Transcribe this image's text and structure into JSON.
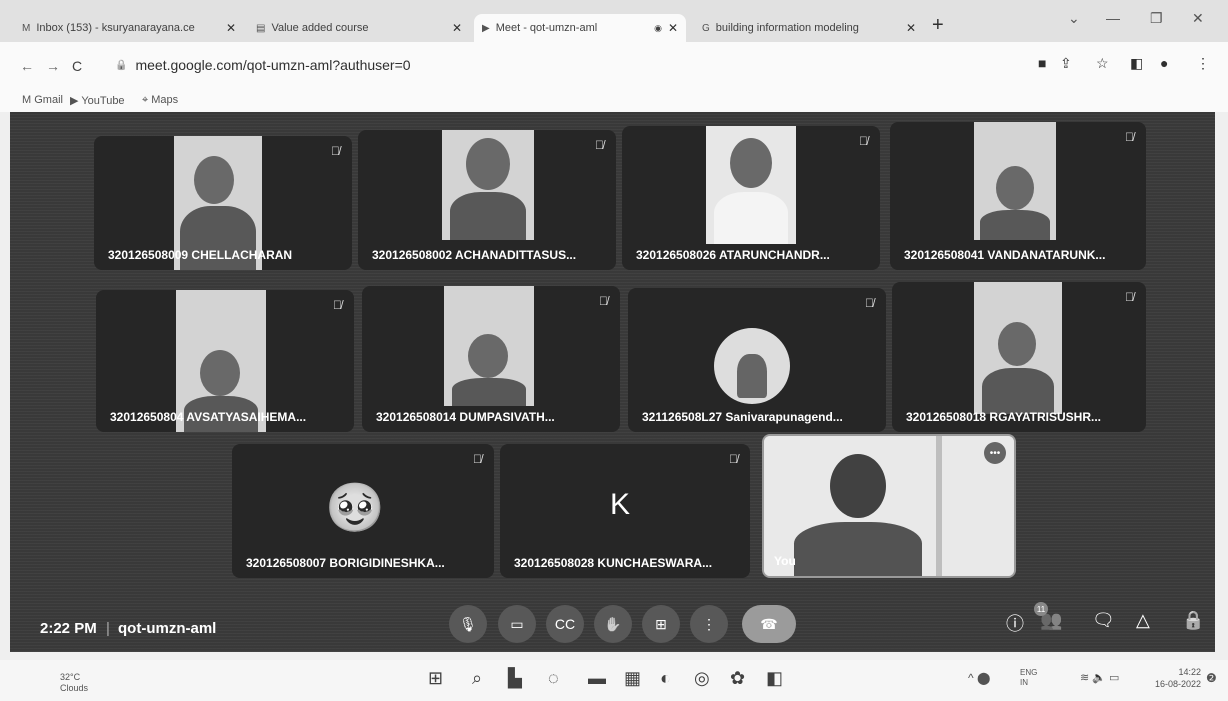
{
  "browser": {
    "tabs": [
      {
        "title": "Inbox (153) - ksuryanarayana.ce",
        "close": "✕"
      },
      {
        "title": "Value added course",
        "close": "✕"
      },
      {
        "title": "Meet - qot-umzn-aml",
        "close": "✕"
      },
      {
        "title": "building information modeling",
        "close": "✕"
      }
    ],
    "new_tab": "+",
    "url": "meet.google.com/qot-umzn-aml?authuser=0",
    "bookmarks": [
      "Gmail",
      "YouTube",
      "Maps"
    ]
  },
  "meet": {
    "participants": [
      {
        "name": "320126508009 CHELLACHARAN"
      },
      {
        "name": "320126508002 ACHANADITTASUS..."
      },
      {
        "name": "320126508026 ATARUNCHANDR..."
      },
      {
        "name": "320126508041 VANDANATARUNK..."
      },
      {
        "name": "32012650804 AVSATYASAIHEMA..."
      },
      {
        "name": "320126508014 DUMPASIVATH..."
      },
      {
        "name": "321126508L27 Sanivarapunagend..."
      },
      {
        "name": "320126508018 RGAYATRISUSHR..."
      },
      {
        "name": "320126508007 BORIGIDINESHKA..."
      },
      {
        "name": "320126508028 KUNCHAESWARA..."
      },
      {
        "name": "You"
      }
    ],
    "avatar_letter": "K",
    "avatar_emoji": "🥹",
    "time": "2:22 PM",
    "separator": "|",
    "meeting_code": "qot-umzn-aml",
    "participant_count": "11"
  },
  "taskbar": {
    "temperature": "32°C",
    "condition": "Clouds",
    "lang_top": "ENG",
    "lang_bottom": "IN",
    "time": "14:22",
    "date": "16-08-2022"
  }
}
